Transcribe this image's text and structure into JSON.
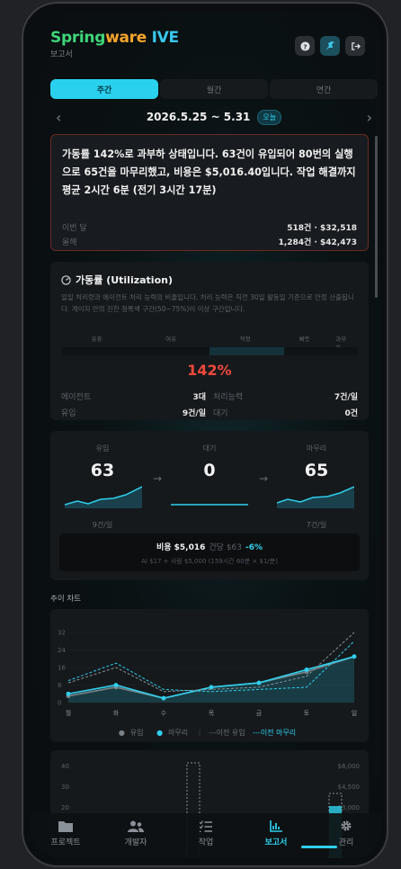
{
  "app": {
    "brand_part1": "Spring",
    "brand_part2": "ware",
    "brand_part3": "IVE",
    "subtitle": "보고서"
  },
  "header_icons": [
    "help-icon",
    "bird-icon",
    "logout-icon"
  ],
  "tabs": [
    {
      "label": "주간",
      "active": true
    },
    {
      "label": "월간",
      "active": false
    },
    {
      "label": "연간",
      "active": false
    }
  ],
  "date": {
    "range": "2026.5.25 ~ 5.31",
    "today_badge": "오늘"
  },
  "summary": {
    "text": "가동률 142%로 과부하 상태입니다. 63건이 유입되어 80번의 실행으로 65건을 마무리했고, 비용은 $5,016.40입니다. 작업 해결까지 평균 2시간 6분 (전기 3시간 17분)",
    "rows": [
      {
        "label": "이번 달",
        "value": "518건 · $32,518"
      },
      {
        "label": "올해",
        "value": "1,284건 · $42,473"
      }
    ]
  },
  "utilization": {
    "title": "가동률 (Utilization)",
    "description": "일일 처리량과 에이전트 처리 능력의 비율입니다. 처리 능력은 직전 30일 활동일 기준으로 안정 산출됩니다. 게이지 안의 진한 청록색 구간(50~75%)이 이상 구간입니다.",
    "gauge_labels": [
      "유휴",
      "여유",
      "적정",
      "빠듯",
      "과부하"
    ],
    "percent": "142%",
    "rows": [
      {
        "label": "에이전트",
        "value": "3대",
        "label2": "처리능력",
        "value2": "7건/일"
      },
      {
        "label": "유입",
        "value": "9건/일",
        "label2": "대기",
        "value2": "0건"
      }
    ]
  },
  "flow": {
    "inflow": {
      "label": "유입",
      "value": "63",
      "rate": "9건/일"
    },
    "waiting": {
      "label": "대기",
      "value": "0"
    },
    "done": {
      "label": "마무리",
      "value": "65",
      "rate": "7건/일"
    },
    "cost_label": "비용 $5,016",
    "per_item": "건당 $63",
    "change": "-6%",
    "breakdown": "AI $17  +  사람 $5,000 (159시간 60분 × $1/분)"
  },
  "trend_title": "추이 차트",
  "chart_data": {
    "type": "line",
    "categories": [
      "월",
      "화",
      "수",
      "목",
      "금",
      "토",
      "일"
    ],
    "ylim": [
      0,
      32
    ],
    "yticks": [
      0,
      8,
      16,
      24,
      32
    ],
    "series": [
      {
        "name": "유입",
        "values": [
          3,
          7,
          2,
          7,
          9,
          14,
          21
        ],
        "color": "#7a8288"
      },
      {
        "name": "마무리",
        "values": [
          4,
          8,
          2,
          7,
          9,
          15,
          21
        ],
        "color": "#2ed0ee"
      },
      {
        "name": "이전 유입",
        "values": [
          9,
          16,
          5,
          6,
          7,
          12,
          32
        ],
        "color": "#8a9096",
        "dashed": true
      },
      {
        "name": "이전 마무리",
        "values": [
          10,
          18,
          6,
          5,
          6,
          7,
          28
        ],
        "color": "#2ed0ee",
        "dashed": true
      }
    ]
  },
  "legend": {
    "inflow": "유입",
    "done": "마무리",
    "sep": "|",
    "prev_inflow": "---이전 유입",
    "prev_done": "---이전 마무리"
  },
  "chart2": {
    "left_ticks": [
      "40",
      "30",
      "20"
    ],
    "right_ticks": [
      "$6,000",
      "$4,500",
      "$3,000"
    ]
  },
  "nav": [
    {
      "label": "프로젝트",
      "icon": "folder-icon"
    },
    {
      "label": "개발자",
      "icon": "users-icon"
    },
    {
      "label": "작업",
      "icon": "checklist-icon"
    },
    {
      "label": "보고서",
      "icon": "report-icon",
      "active": true
    },
    {
      "label": "관리",
      "icon": "gear-icon"
    }
  ]
}
